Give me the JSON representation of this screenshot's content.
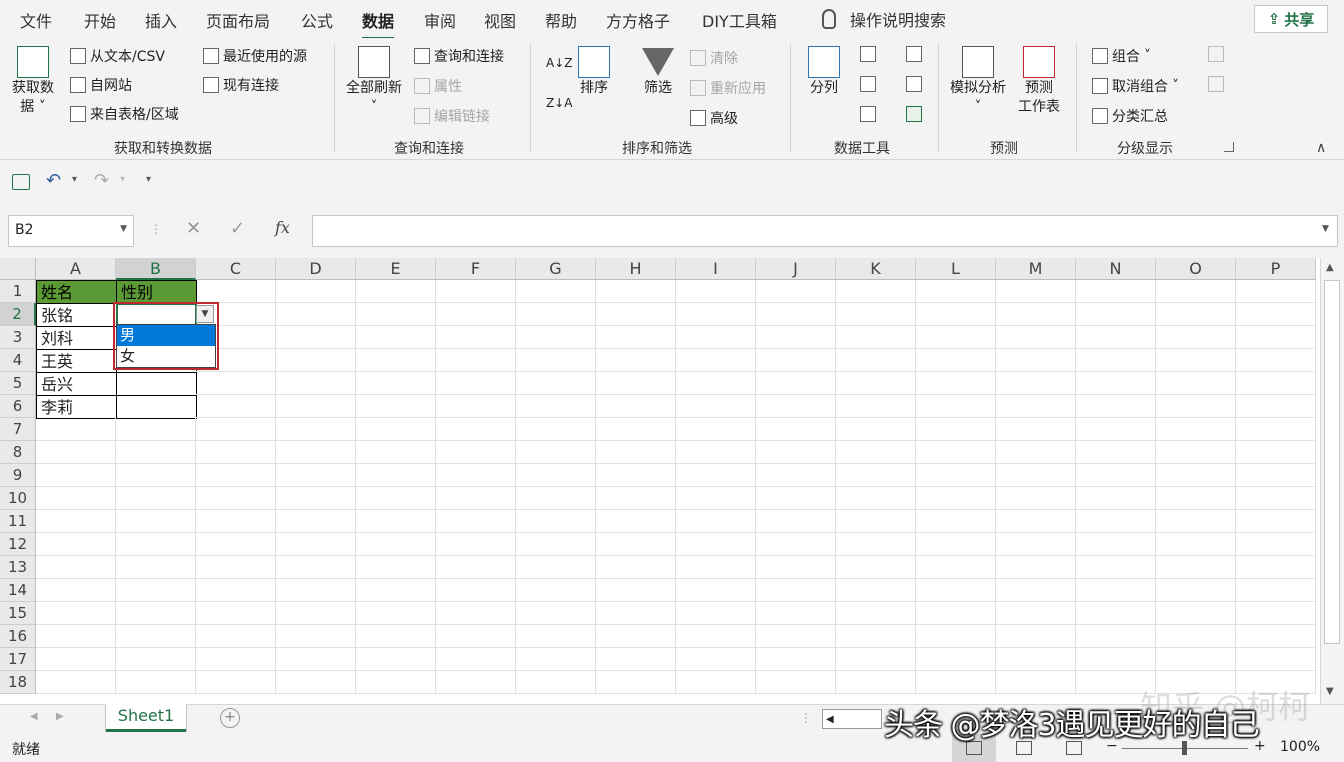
{
  "tabs": [
    "文件",
    "开始",
    "插入",
    "页面布局",
    "公式",
    "数据",
    "审阅",
    "视图",
    "帮助",
    "方方格子",
    "DIY工具箱"
  ],
  "active_tab": "数据",
  "tell_me": "操作说明搜索",
  "share": "共享",
  "share_icon": "share-icon",
  "ribbon": {
    "get_data": {
      "line1": "获取数",
      "line2": "据 ˅",
      "from_text": "从文本/CSV",
      "from_web": "自网站",
      "from_table": "来自表格/区域",
      "recent": "最近使用的源",
      "existing": "现有连接",
      "label": "获取和转换数据"
    },
    "queries": {
      "refresh_all": "全部刷新",
      "refresh_arrow": "˅",
      "queries_conn": "查询和连接",
      "properties": "属性",
      "edit_links": "编辑链接",
      "label": "查询和连接"
    },
    "sort": {
      "sort": "排序",
      "filter": "筛选",
      "clear": "清除",
      "reapply": "重新应用",
      "advanced": "高级",
      "label": "排序和筛选"
    },
    "tools": {
      "split": "分列",
      "label": "数据工具"
    },
    "forecast": {
      "whatif": "模拟分析",
      "whatif_arrow": "˅",
      "sheet_l1": "预测",
      "sheet_l2": "工作表",
      "label": "预测"
    },
    "outline": {
      "group": "组合",
      "ungroup": "取消组合",
      "subtotal": "分类汇总",
      "label": "分级显示"
    }
  },
  "namebox": "B2",
  "fx": "fx",
  "columns": [
    "A",
    "B",
    "C",
    "D",
    "E",
    "F",
    "G",
    "H",
    "I",
    "J",
    "K",
    "L",
    "M",
    "N",
    "O",
    "P"
  ],
  "rows": [
    "1",
    "2",
    "3",
    "4",
    "5",
    "6",
    "7",
    "8",
    "9",
    "10",
    "11",
    "12",
    "13",
    "14",
    "15",
    "16",
    "17",
    "18"
  ],
  "cells": {
    "A1": "姓名",
    "B1": "性别",
    "A2": "张铭",
    "A3": "刘科",
    "A4": "王英",
    "A5": "岳兴",
    "A6": "李莉"
  },
  "dropdown": {
    "options": [
      "男",
      "女"
    ],
    "highlighted": "男"
  },
  "sheet": "Sheet1",
  "status": "就绪",
  "zoom": "100%",
  "zoom_minus": "−",
  "zoom_plus": "+",
  "watermark": "头条 @梦洛3遇见更好的自己",
  "watermark2": "知乎 @柯柯",
  "colors": {
    "accent": "#217346",
    "header_fill": "#5b9a35",
    "highlight": "#0078d7",
    "red_box": "#c0282e"
  }
}
